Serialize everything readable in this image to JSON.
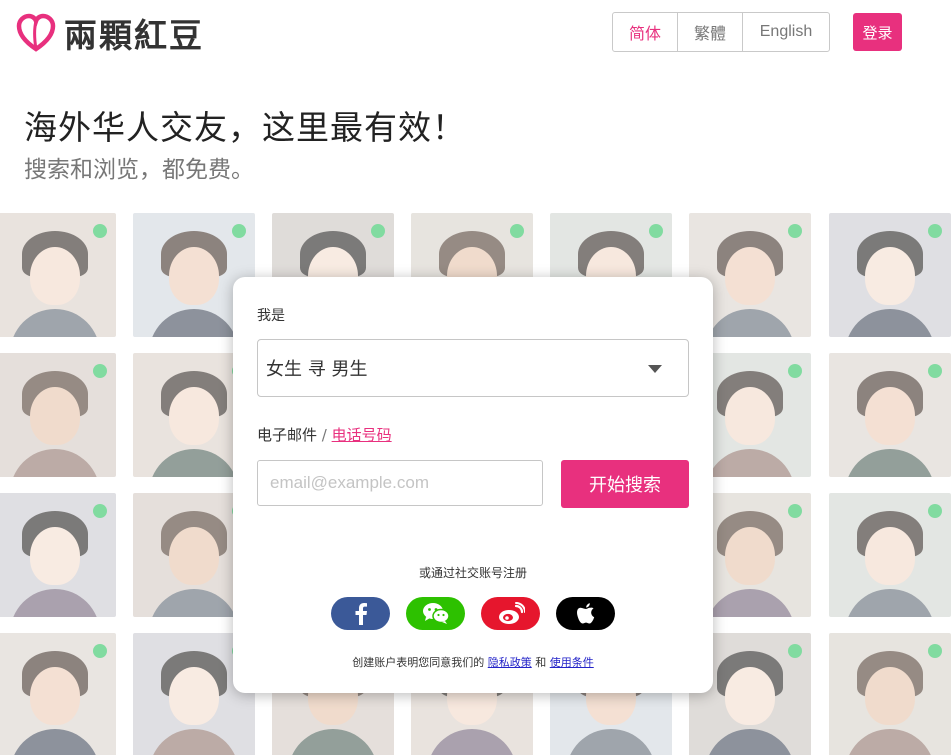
{
  "header": {
    "logo_text": "兩顆紅豆",
    "languages": [
      "简体",
      "繁體",
      "English"
    ],
    "login_label": "登录"
  },
  "hero": {
    "headline": "海外华人交友，这里最有效！",
    "subline": "搜索和浏览，都免费。"
  },
  "form": {
    "iam_label": "我是",
    "gender_select": "女生 寻 男生",
    "email_label": "电子邮件",
    "separator": " / ",
    "phone_label": "电话号码",
    "email_placeholder": "email@example.com",
    "search_button": "开始搜索",
    "social_label": "或通过社交账号注册",
    "terms_prefix": "创建账户表明您同意我们的 ",
    "privacy_link": "隐私政策",
    "terms_and": " 和 ",
    "terms_link": "使用条件"
  },
  "social_icons": [
    "facebook-icon",
    "wechat-icon",
    "weibo-icon",
    "apple-icon"
  ],
  "colors": {
    "brand_pink": "#e8307e",
    "online_green": "#26c15c",
    "facebook": "#3b5998",
    "wechat": "#2dc100",
    "weibo": "#e6162d",
    "apple": "#000000"
  }
}
